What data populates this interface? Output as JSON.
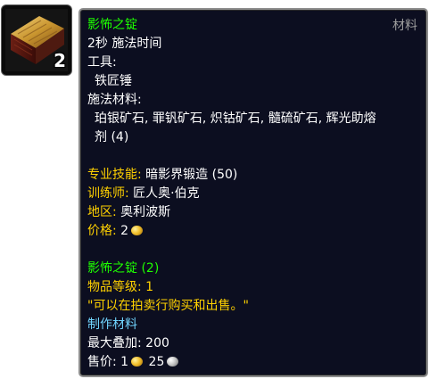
{
  "item": {
    "icon": "shadowforged-ingot-icon",
    "stack_count": "2"
  },
  "tooltip": {
    "spell_name": "影怖之锭",
    "category": "材料",
    "cast_time": "2秒 施法时间",
    "tools_label": "工具:",
    "tool": "铁匠锤",
    "reagents_label": "施法材料:",
    "reagents_line1": "珀银矿石, 罪钒矿石, 炽钴矿石, 髓硫矿石, 辉光助熔",
    "reagents_line2": "剂 (4)",
    "profession_label": "专业技能:",
    "profession_value": "暗影界锻造 (50)",
    "trainer_label": "训练师:",
    "trainer_value": "匠人奥·伯克",
    "zone_label": "地区:",
    "zone_value": "奥利波斯",
    "price_label": "价格:",
    "price_gold": "2",
    "created_item": "影怖之锭 (2)",
    "item_level_label": "物品等级:",
    "item_level": "1",
    "flavor_text": "\"可以在拍卖行购买和出售。\"",
    "crafting_reagent": "制作材料",
    "max_stack_label": "最大叠加:",
    "max_stack": "200",
    "sell_price_label": "售价:",
    "sell_gold": "1",
    "sell_silver": "25"
  },
  "colors": {
    "green": "#1eff00",
    "yellow": "#ffd100",
    "blue": "#71d5ff",
    "grey": "#9d9d9d",
    "tooltip_bg": "#0c0e20"
  }
}
